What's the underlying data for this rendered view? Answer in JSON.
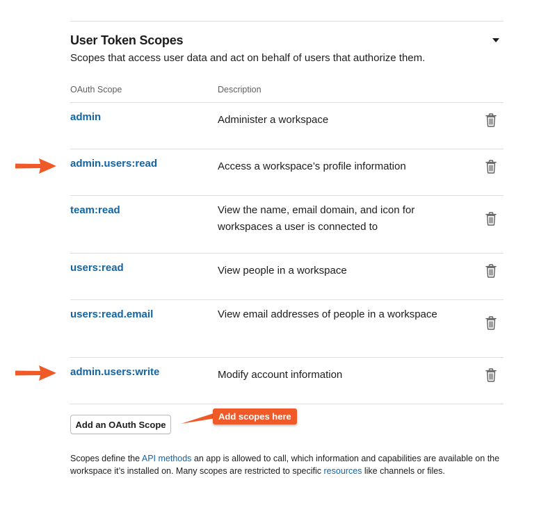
{
  "section": {
    "title": "User Token Scopes",
    "subtitle": "Scopes that access user data and act on behalf of users that authorize them."
  },
  "table": {
    "columns": {
      "scope": "OAuth Scope",
      "description": "Description"
    },
    "rows": [
      {
        "scope": "admin",
        "description": "Administer a workspace"
      },
      {
        "scope": "admin.users:read",
        "description": "Access a workspace’s profile information"
      },
      {
        "scope": "team:read",
        "description": "View the name, email domain, and icon for workspaces a user is connected to"
      },
      {
        "scope": "users:read",
        "description": "View people in a workspace"
      },
      {
        "scope": "users:read.email",
        "description": "View email addresses of people in a workspace"
      },
      {
        "scope": "admin.users:write",
        "description": "Modify account information"
      }
    ]
  },
  "add_scope_button": "Add an OAuth Scope",
  "callout": "Add scopes here",
  "footer": {
    "part1": "Scopes define the ",
    "link1": "API methods",
    "part2": " an app is allowed to call, which information and capabilities are available on the workspace it’s installed on. Many scopes are restricted to specific ",
    "link2": "resources",
    "part3": " like channels or files."
  },
  "icons": {
    "collapse": "caret-down-icon",
    "remove": "trash-icon",
    "annotation": "arrow-right-icon"
  },
  "colors": {
    "link": "#1264a3",
    "annotation": "#f05a28",
    "text": "#1d1c1d",
    "muted": "#616061",
    "divider": "#dddddd"
  }
}
